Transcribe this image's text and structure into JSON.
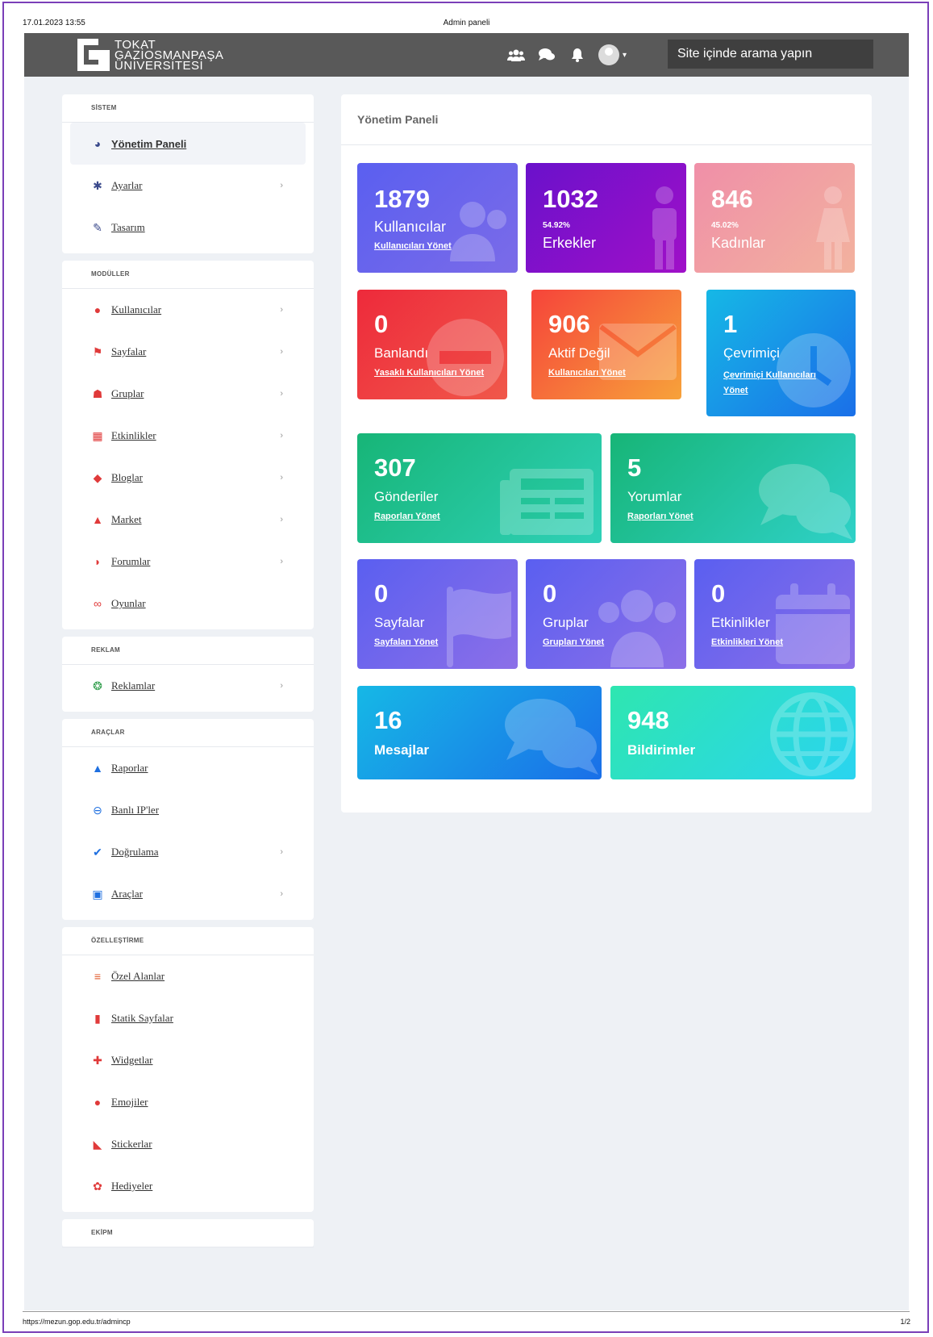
{
  "print": {
    "date": "17.01.2023 13:55",
    "title": "Admin paneli",
    "url": "https://mezun.gop.edu.tr/admincp",
    "page": "1/2"
  },
  "header": {
    "logo_text": "TOKAT\nGAZİOSMANPAŞA\nÜNİVERSİTESİ",
    "search_placeholder": "Site içinde arama yapın"
  },
  "sidebar": {
    "groups": [
      {
        "title": "SİSTEM",
        "items": [
          {
            "label": "Yönetim Paneli",
            "icon": "dashboard-icon",
            "color": "#3b4a8c",
            "active": true
          },
          {
            "label": "Ayarlar",
            "icon": "gear-icon",
            "color": "#3b4a8c",
            "chevron": true
          },
          {
            "label": "Tasarım",
            "icon": "brush-icon",
            "color": "#3b4a8c"
          }
        ]
      },
      {
        "title": "MODÜLLER",
        "items": [
          {
            "label": "Kullanıcılar",
            "icon": "user-icon",
            "color": "#e03a3a",
            "chevron": true
          },
          {
            "label": "Sayfalar",
            "icon": "flag-icon",
            "color": "#e03a3a",
            "chevron": true
          },
          {
            "label": "Gruplar",
            "icon": "users-icon",
            "color": "#e03a3a",
            "chevron": true
          },
          {
            "label": "Etkinlikler",
            "icon": "calendar-icon",
            "color": "#e03a3a",
            "chevron": true
          },
          {
            "label": "Bloglar",
            "icon": "blog-icon",
            "color": "#e03a3a",
            "chevron": true
          },
          {
            "label": "Market",
            "icon": "bag-icon",
            "color": "#e03a3a",
            "chevron": true
          },
          {
            "label": "Forumlar",
            "icon": "comments-icon",
            "color": "#e03a3a",
            "chevron": true
          },
          {
            "label": "Oyunlar",
            "icon": "gamepad-icon",
            "color": "#e03a3a"
          }
        ]
      },
      {
        "title": "REKLAM",
        "items": [
          {
            "label": "Reklamlar",
            "icon": "ads-icon",
            "color": "#2e9c4a",
            "chevron": true
          }
        ]
      },
      {
        "title": "ARAÇLAR",
        "items": [
          {
            "label": "Raporlar",
            "icon": "warning-icon",
            "color": "#1e6fe0"
          },
          {
            "label": "Banlı IP'ler",
            "icon": "ban-icon",
            "color": "#1e6fe0"
          },
          {
            "label": "Doğrulama",
            "icon": "check-circle-icon",
            "color": "#1e6fe0",
            "chevron": true
          },
          {
            "label": "Araçlar",
            "icon": "toolbox-icon",
            "color": "#1e6fe0",
            "chevron": true
          }
        ]
      },
      {
        "title": "ÖZELLEŞTİRME",
        "items": [
          {
            "label": "Özel Alanlar",
            "icon": "list-icon",
            "color": "#e05a2a"
          },
          {
            "label": "Statik Sayfalar",
            "icon": "file-icon",
            "color": "#e03a3a"
          },
          {
            "label": "Widgetlar",
            "icon": "puzzle-icon",
            "color": "#e03a3a"
          },
          {
            "label": "Emojiler",
            "icon": "emoji-icon",
            "color": "#e03a3a"
          },
          {
            "label": "Stickerlar",
            "icon": "sticker-icon",
            "color": "#e03a3a"
          },
          {
            "label": "Hediyeler",
            "icon": "gift-icon",
            "color": "#e03a3a"
          }
        ]
      },
      {
        "title": "EKİPM",
        "items": []
      }
    ]
  },
  "main": {
    "title": "Yönetim Paneli",
    "cards": {
      "users": {
        "num": "1879",
        "label": "Kullanıcılar",
        "link": "Kullanıcıları Yönet"
      },
      "males": {
        "num": "1032",
        "sub": "54.92%",
        "label": "Erkekler"
      },
      "females": {
        "num": "846",
        "sub": "45.02%",
        "label": "Kadınlar"
      },
      "banned": {
        "num": "0",
        "label": "Banlandı",
        "link": "Yasaklı Kullanıcıları Yönet"
      },
      "inactive": {
        "num": "906",
        "label": "Aktif Değil",
        "link": "Kullanıcıları Yönet"
      },
      "online": {
        "num": "1",
        "label": "Çevrimiçi",
        "link": "Çevrimiçi Kullanıcıları Yönet"
      },
      "posts": {
        "num": "307",
        "label": "Gönderiler",
        "link": "Raporları Yönet"
      },
      "comments": {
        "num": "5",
        "label": "Yorumlar",
        "link": "Raporları Yönet"
      },
      "pages": {
        "num": "0",
        "label": "Sayfalar",
        "link": "Sayfaları Yönet"
      },
      "groups": {
        "num": "0",
        "label": "Gruplar",
        "link": "Grupları Yönet"
      },
      "events": {
        "num": "0",
        "label": "Etkinlikler",
        "link": "Etkinlikleri Yönet"
      },
      "messages": {
        "num": "16",
        "label": "Mesajlar"
      },
      "notifications": {
        "num": "948",
        "label": "Bildirimler"
      }
    }
  }
}
